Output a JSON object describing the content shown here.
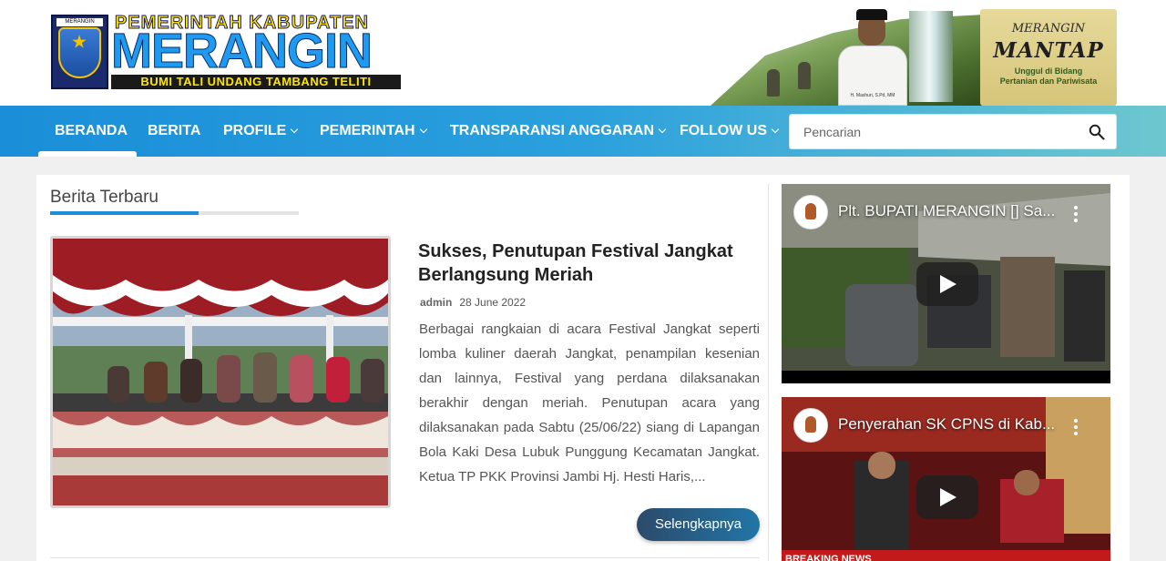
{
  "header": {
    "logo_top": "PEMERINTAH KABUPATEN",
    "logo_main": "MERANGIN",
    "logo_tagline": "BUMI TALI UNDANG TAMBANG TELITI",
    "emblem_label": "MERANGIN",
    "banner": {
      "line1": "MERANGIN",
      "line2": "MANTAP",
      "line3": "Unggul di Bidang",
      "line4": "Pertanian dan Pariwisata",
      "caption": "H. Mashuri, S.Pd, MM"
    }
  },
  "nav": {
    "items": [
      {
        "label": "BERANDA",
        "dropdown": false,
        "active": true
      },
      {
        "label": "BERITA",
        "dropdown": false,
        "active": false
      },
      {
        "label": "PROFILE",
        "dropdown": true,
        "active": false
      },
      {
        "label": "PEMERINTAH",
        "dropdown": true,
        "active": false
      },
      {
        "label": "TRANSPARANSI ANGGARAN",
        "dropdown": true,
        "active": false
      },
      {
        "label": "FOLLOW US",
        "dropdown": true,
        "active": false
      }
    ],
    "search_placeholder": "Pencarian",
    "search_value": ""
  },
  "main": {
    "section_title": "Berita Terbaru",
    "article": {
      "title": "Sukses, Penutupan Festival Jangkat Berlangsung Meriah",
      "author": "admin",
      "date": "28 June 2022",
      "excerpt": "Berbagai rangkaian di acara Festival Jangkat seperti lomba kuliner daerah Jangkat, penampilan kesenian dan lainnya, Festival yang perdana dilaksanakan berakhir dengan meriah. Penutupan acara yang dilaksanakan pada Sabtu (25/06/22) siang di Lapangan Bola Kaki Desa Lubuk Punggung Kecamatan Jangkat.    Ketua TP PKK Provinsi Jambi Hj. Hesti Haris,...",
      "more_label": "Selengkapnya"
    }
  },
  "sidebar": {
    "videos": [
      {
        "title": "Plt. BUPATI MERANGIN [] Sa..."
      },
      {
        "title": "Penyerahan SK CPNS di Kab...",
        "overlay": "BREAKING NEWS"
      }
    ]
  },
  "colors": {
    "nav_start": "#1a8ed8",
    "nav_end": "#6dc7cf",
    "accent": "#1a8ed8",
    "button": "#2c4a6b",
    "logo_blue": "#1e9bf0",
    "logo_yellow": "#ffe600"
  },
  "icons": {
    "search": "search-icon",
    "play": "play-icon",
    "more": "more-vert-icon",
    "chevron": "chevron-down-icon"
  }
}
